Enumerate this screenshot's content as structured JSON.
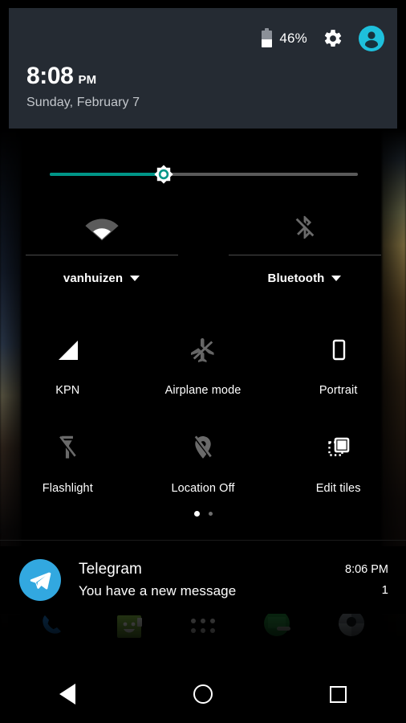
{
  "header": {
    "battery": {
      "icon": "battery-icon",
      "percent_label": "46%",
      "level": 46
    },
    "settings": {
      "icon": "gear-icon",
      "label": "Settings"
    },
    "user": {
      "icon": "user-avatar-icon",
      "label": "User",
      "color": "#1ec0dc"
    },
    "clock": {
      "time": "8:08",
      "ampm": "PM",
      "date": "Sunday, February 7"
    },
    "background_color": "#252b33"
  },
  "brightness": {
    "name": "brightness-slider",
    "value": 37,
    "fill_color": "#009688",
    "track_color": "#5a5a5a",
    "thumb_icon": "brightness-sun-icon"
  },
  "connectivity": [
    {
      "id": "wifi",
      "icon": "wifi-icon",
      "label": "vanhuizen",
      "state": "on",
      "expandable": true,
      "caret": "chevron-down-icon"
    },
    {
      "id": "bluetooth",
      "icon": "bluetooth-off-icon",
      "label": "Bluetooth",
      "state": "off",
      "expandable": true,
      "caret": "chevron-down-icon"
    }
  ],
  "tiles": [
    [
      {
        "id": "cellular",
        "icon": "signal-bars-icon",
        "label": "KPN",
        "state": "on"
      },
      {
        "id": "airplane",
        "icon": "airplane-off-icon",
        "label": "Airplane mode",
        "state": "off"
      },
      {
        "id": "rotation",
        "icon": "portrait-phone-icon",
        "label": "Portrait",
        "state": "on"
      }
    ],
    [
      {
        "id": "flashlight",
        "icon": "flashlight-off-icon",
        "label": "Flashlight",
        "state": "off"
      },
      {
        "id": "location",
        "icon": "location-off-icon",
        "label": "Location Off",
        "state": "off"
      },
      {
        "id": "edit",
        "icon": "edit-tiles-icon",
        "label": "Edit tiles",
        "state": "on"
      }
    ]
  ],
  "pager": {
    "pages": 2,
    "active": 1
  },
  "notification": {
    "app_icon": "telegram-icon",
    "app_icon_color": "#32a8e0",
    "title": "Telegram",
    "text": "You have a new message",
    "time": "8:06 PM",
    "count": "1"
  },
  "dock": [
    {
      "id": "phone",
      "icon": "phone-icon"
    },
    {
      "id": "messages",
      "icon": "messages-icon"
    },
    {
      "id": "app-drawer",
      "icon": "app-drawer-icon"
    },
    {
      "id": "green-app",
      "icon": "green-app-icon"
    },
    {
      "id": "camera",
      "icon": "camera-icon"
    }
  ],
  "navbar": [
    {
      "id": "back",
      "icon": "back-triangle-icon",
      "label": "Back"
    },
    {
      "id": "home",
      "icon": "home-circle-icon",
      "label": "Home"
    },
    {
      "id": "recents",
      "icon": "recents-square-icon",
      "label": "Recents"
    }
  ]
}
